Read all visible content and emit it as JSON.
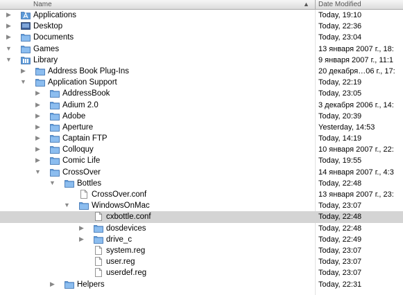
{
  "header": {
    "name_label": "Name",
    "date_label": "Date Modified",
    "sort_indicator": "▲"
  },
  "rows": [
    {
      "name": "Applications",
      "date": "Today, 19:10",
      "depth": 0,
      "kind": "apps",
      "state": "collapsed"
    },
    {
      "name": "Desktop",
      "date": "Today, 22:36",
      "depth": 0,
      "kind": "desktop",
      "state": "collapsed"
    },
    {
      "name": "Documents",
      "date": "Today, 23:04",
      "depth": 0,
      "kind": "folder",
      "state": "collapsed"
    },
    {
      "name": "Games",
      "date": "13 января 2007 г., 18:",
      "depth": 0,
      "kind": "folder",
      "state": "expanded"
    },
    {
      "name": "Library",
      "date": "9 января 2007 г., 11:1",
      "depth": 0,
      "kind": "library",
      "state": "expanded"
    },
    {
      "name": "Address Book Plug-Ins",
      "date": "20 декабря…06 г., 17:",
      "depth": 1,
      "kind": "folder",
      "state": "collapsed"
    },
    {
      "name": "Application Support",
      "date": "Today, 22:19",
      "depth": 1,
      "kind": "folder",
      "state": "expanded"
    },
    {
      "name": "AddressBook",
      "date": "Today, 23:05",
      "depth": 2,
      "kind": "folder",
      "state": "collapsed"
    },
    {
      "name": "Adium 2.0",
      "date": "3 декабря 2006 г., 14:",
      "depth": 2,
      "kind": "folder",
      "state": "collapsed"
    },
    {
      "name": "Adobe",
      "date": "Today, 20:39",
      "depth": 2,
      "kind": "folder",
      "state": "collapsed"
    },
    {
      "name": "Aperture",
      "date": "Yesterday, 14:53",
      "depth": 2,
      "kind": "folder",
      "state": "collapsed"
    },
    {
      "name": "Captain FTP",
      "date": "Today, 14:19",
      "depth": 2,
      "kind": "folder",
      "state": "collapsed"
    },
    {
      "name": "Colloquy",
      "date": "10 января 2007 г., 22:",
      "depth": 2,
      "kind": "folder",
      "state": "collapsed"
    },
    {
      "name": "Comic Life",
      "date": "Today, 19:55",
      "depth": 2,
      "kind": "folder",
      "state": "collapsed"
    },
    {
      "name": "CrossOver",
      "date": "14 января 2007 г., 4:3",
      "depth": 2,
      "kind": "folder",
      "state": "expanded"
    },
    {
      "name": "Bottles",
      "date": "Today, 22:48",
      "depth": 3,
      "kind": "folder",
      "state": "expanded"
    },
    {
      "name": "CrossOver.conf",
      "date": "13 января 2007 г., 23:",
      "depth": 4,
      "kind": "file",
      "state": "none"
    },
    {
      "name": "WindowsOnMac",
      "date": "Today, 23:07",
      "depth": 4,
      "kind": "folder",
      "state": "expanded"
    },
    {
      "name": "cxbottle.conf",
      "date": "Today, 22:48",
      "depth": 5,
      "kind": "file",
      "state": "none",
      "selected": true
    },
    {
      "name": "dosdevices",
      "date": "Today, 22:48",
      "depth": 5,
      "kind": "folder",
      "state": "collapsed"
    },
    {
      "name": "drive_c",
      "date": "Today, 22:49",
      "depth": 5,
      "kind": "folder",
      "state": "collapsed"
    },
    {
      "name": "system.reg",
      "date": "Today, 23:07",
      "depth": 5,
      "kind": "file",
      "state": "none"
    },
    {
      "name": "user.reg",
      "date": "Today, 23:07",
      "depth": 5,
      "kind": "file",
      "state": "none"
    },
    {
      "name": "userdef.reg",
      "date": "Today, 23:07",
      "depth": 5,
      "kind": "file",
      "state": "none"
    },
    {
      "name": "Helpers",
      "date": "Today, 22:31",
      "depth": 3,
      "kind": "folder",
      "state": "collapsed"
    }
  ],
  "colors": {
    "selection": "#d4d4d4",
    "folder_blue": "#5d9ad8",
    "triangle": "#888888"
  }
}
